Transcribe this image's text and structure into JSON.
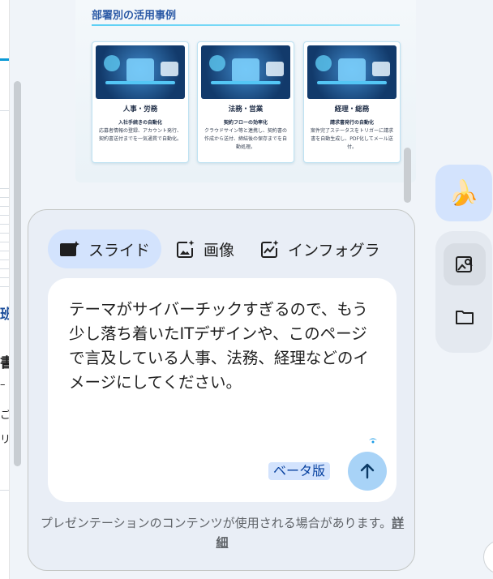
{
  "left_fragments": [
    "班",
    "書",
    "–",
    "ご",
    "リ"
  ],
  "preview": {
    "title": "部署別の活用事例",
    "cards": [
      {
        "title": "人事・労務",
        "subtitle": "入社手続きの自動化",
        "desc": "応募者情報の登録、アカウント発行、契約書送付までを一気通貫で自動化。"
      },
      {
        "title": "法務・営業",
        "subtitle": "契約フローの効率化",
        "desc": "クラウドサイン等と連携し、契約書の作成から送付、締結後の保存までを自動処理。"
      },
      {
        "title": "経理・総務",
        "subtitle": "請求書発行の自動化",
        "desc": "案件完了ステータスをトリガーに請求書を自動生成し、PDF化してメール送付。"
      }
    ]
  },
  "tabs": [
    {
      "label": "スライド",
      "icon": "slides-icon",
      "active": true
    },
    {
      "label": "画像",
      "icon": "image-sparkle-icon",
      "active": false
    },
    {
      "label": "インフォグラ",
      "icon": "infographic-icon",
      "active": false
    }
  ],
  "prompt": {
    "text": "テーマがサイバーチックすぎるので、もう少し落ち着いたITデザインや、このページで言及している人事、法務、経理などのイメージにしてください。"
  },
  "beta_label": "ベータ版",
  "footer": {
    "text": "プレゼンテーションのコンテンツが使用される場合があります。",
    "link": "詳細"
  },
  "rail": {
    "top_icon": "🍌",
    "icons": [
      "image-search-icon",
      "folder-icon"
    ]
  },
  "colors": {
    "accent": "#d3e3fd",
    "send": "#a8d3f7",
    "brand": "#0b57d0"
  }
}
